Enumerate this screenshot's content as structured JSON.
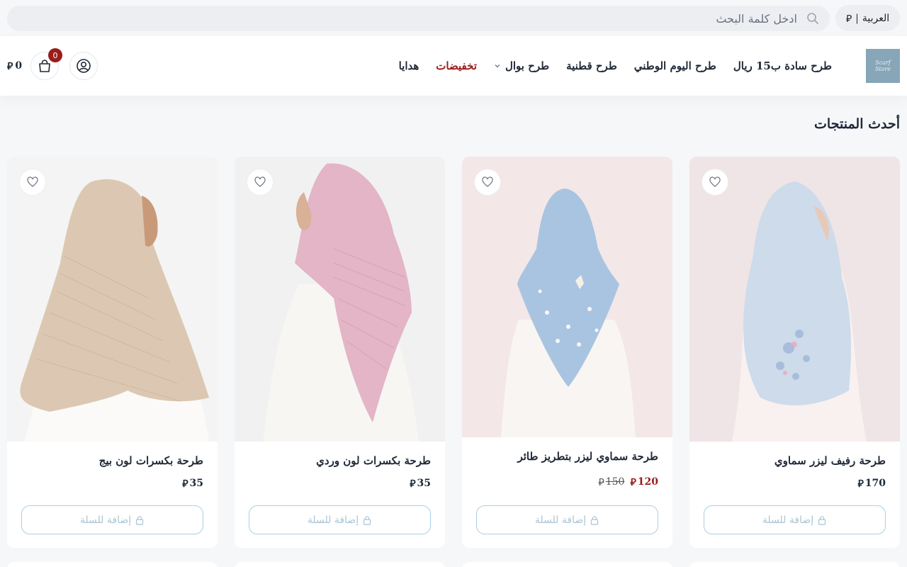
{
  "topbar": {
    "language_label": "العربية",
    "currency_symbol": "⃁",
    "search_placeholder": "ادخل كلمة البحث"
  },
  "header": {
    "logo_text_line1": "Scarf",
    "logo_text_line2": "Store",
    "nav": [
      {
        "label": "طرح سادة ب15 ريال"
      },
      {
        "label": "طرح اليوم الوطني"
      },
      {
        "label": "طرح قطنية"
      },
      {
        "label": "طرح بوال"
      },
      {
        "label": "تخفيضات"
      },
      {
        "label": "هدايا"
      }
    ],
    "cart_count": "0",
    "cart_total": "0"
  },
  "section": {
    "title": "أحدث المنتجات"
  },
  "products": [
    {
      "name": "طرحة رفيف ليزر سماوي",
      "price": "170",
      "old_price": "",
      "add_label": "إضافة للسلة",
      "scarf_color": "#cddbea"
    },
    {
      "name": "طرحة سماوي ليزر بتطريز طائر",
      "price": "120",
      "old_price": "150",
      "add_label": "إضافة للسلة",
      "scarf_color": "#a9c4e0"
    },
    {
      "name": "طرحة بكسرات لون وردي",
      "price": "35",
      "old_price": "",
      "add_label": "إضافة للسلة",
      "scarf_color": "#e3b5c6"
    },
    {
      "name": "طرحة بكسرات لون بيج",
      "price": "35",
      "old_price": "",
      "add_label": "إضافة للسلة",
      "scarf_color": "#dcc8b2"
    }
  ],
  "colors": {
    "accent_red": "#9b1c1c",
    "button_border": "#a9cfe3",
    "logo_bg": "#87a6b8"
  }
}
